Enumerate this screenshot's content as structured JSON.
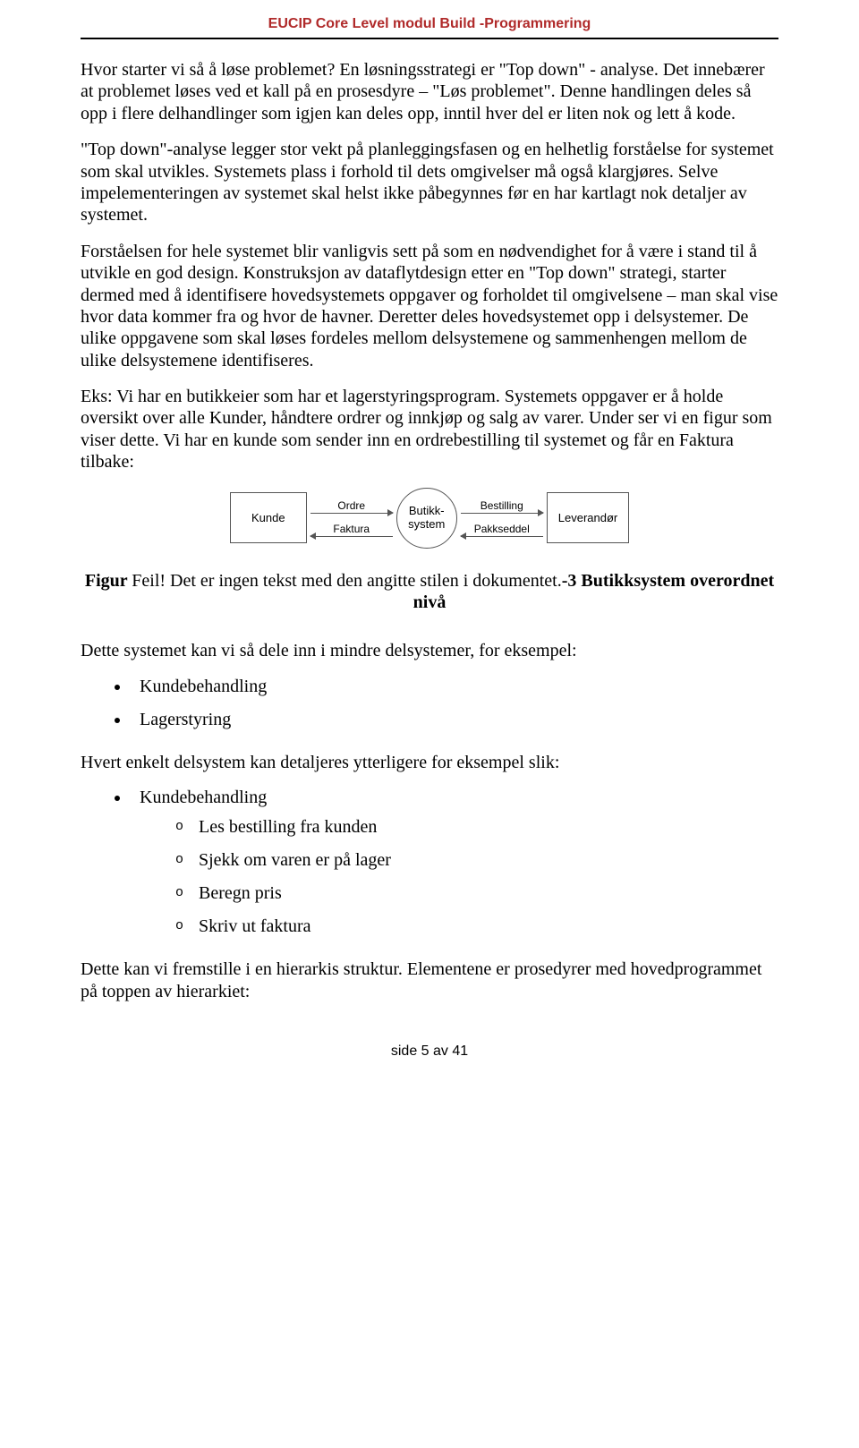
{
  "header": "EUCIP Core Level modul Build -Programmering",
  "p1": "Hvor starter vi så å løse problemet? En løsningsstrategi er \"Top down\" - analyse. Det innebærer at problemet løses ved et kall på en prosesdyre – \"Løs problemet\". Denne handlingen deles så opp i flere delhandlinger som igjen kan deles opp, inntil hver del er liten nok og lett å kode.",
  "p2": "\"Top down\"-analyse legger stor vekt på planleggingsfasen og en helhetlig forståelse for systemet som skal utvikles. Systemets plass i forhold til dets omgivelser må også klargjøres. Selve impelementeringen av systemet skal helst ikke påbegynnes før en har kartlagt nok detaljer av systemet.",
  "p3": "Forståelsen for hele systemet blir vanligvis sett på som en nødvendighet for å være i stand til å utvikle en god design. Konstruksjon av dataflytdesign etter en \"Top down\" strategi, starter dermed med å identifisere hovedsystemets oppgaver og forholdet til omgivelsene – man skal vise hvor data kommer fra og hvor de havner. Deretter deles hovedsystemet opp i delsystemer. De ulike oppgavene som skal løses fordeles mellom delsystemene og sammenhengen mellom de ulike delsystemene identifiseres.",
  "p4": "Eks: Vi har en butikkeier som har et lagerstyringsprogram. Systemets oppgaver er å holde oversikt over alle Kunder, håndtere ordrer og innkjøp og salg av varer. Under ser vi en figur som viser dette.  Vi har en kunde som sender inn en ordrebestilling til systemet og får en Faktura tilbake:",
  "diagram": {
    "left_box": "Kunde",
    "left_top": "Ordre",
    "left_bottom": "Faktura",
    "center": "Butikk-\nsystem",
    "right_top": "Bestilling",
    "right_bottom": "Pakkseddel",
    "right_box": "Leverandør"
  },
  "caption_prefix": "Figur ",
  "caption_error": "Feil! Det er ingen tekst med den angitte stilen i dokumentet.",
  "caption_suffix": "-3 Butikksystem overordnet nivå",
  "p5": "Dette systemet kan vi så dele inn i mindre delsystemer, for eksempel:",
  "subsystems": [
    "Kundebehandling",
    "Lagerstyring"
  ],
  "p6": "Hvert enkelt delsystem kan detaljeres ytterligere for eksempel slik:",
  "detail_group": "Kundebehandling",
  "detail_items": [
    "Les bestilling fra kunden",
    "Sjekk om varen er på lager",
    "Beregn pris",
    "Skriv ut faktura"
  ],
  "p7": "Dette kan vi fremstille i en hierarkis struktur. Elementene er prosedyrer med hovedprogrammet på toppen av hierarkiet:",
  "footer": "side 5 av 41"
}
